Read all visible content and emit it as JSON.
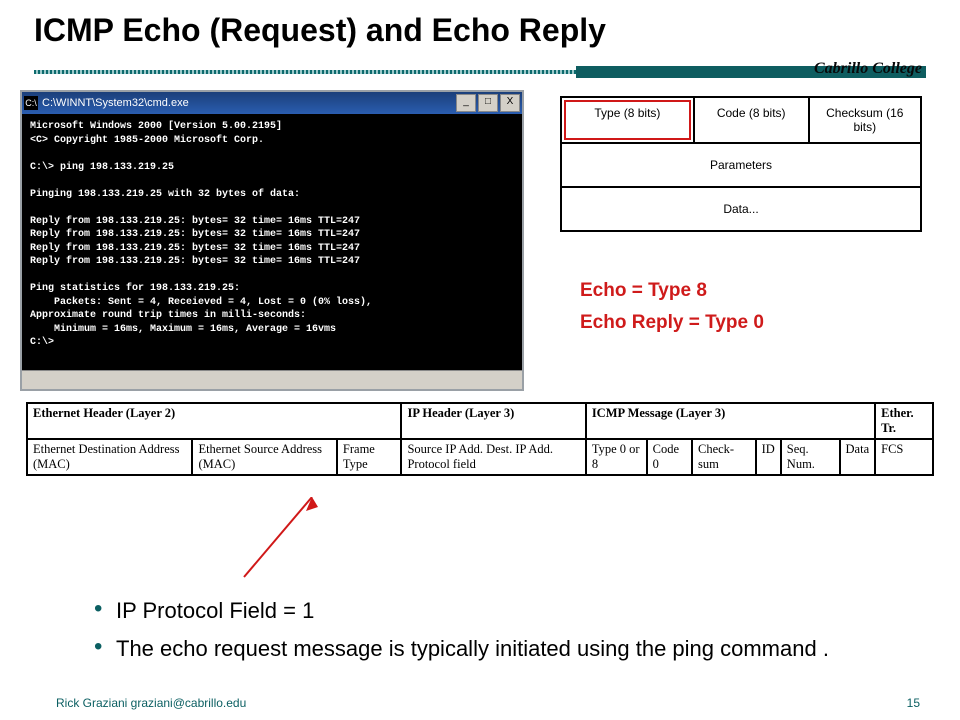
{
  "title": "ICMP Echo (Request) and Echo Reply",
  "brand": "Cabrillo College",
  "cmd": {
    "window_title": "C:\\WINNT\\System32\\cmd.exe",
    "body": "Microsoft Windows 2000 [Version 5.00.2195]\n<C> Copyright 1985-2000 Microsoft Corp.\n\nC:\\> ping 198.133.219.25\n\nPinging 198.133.219.25 with 32 bytes of data:\n\nReply from 198.133.219.25: bytes= 32 time= 16ms TTL=247\nReply from 198.133.219.25: bytes= 32 time= 16ms TTL=247\nReply from 198.133.219.25: bytes= 32 time= 16ms TTL=247\nReply from 198.133.219.25: bytes= 32 time= 16ms TTL=247\n\nPing statistics for 198.133.219.25:\n    Packets: Sent = 4, Receieved = 4, Lost = 0 (0% loss),\nApproximate round trip times in milli-seconds:\n    Minimum = 16ms, Maximum = 16ms, Average = 16vms\nC:\\>"
  },
  "icmp_header": {
    "type": "Type (8 bits)",
    "code": "Code (8 bits)",
    "checksum": "Checksum (16 bits)",
    "parameters": "Parameters",
    "data": "Data..."
  },
  "echo_note": {
    "line1": "Echo = Type 8",
    "line2": "Echo Reply = Type 0"
  },
  "packet": {
    "headers": {
      "eth": "Ethernet Header (Layer 2)",
      "ip": "IP Header (Layer 3)",
      "icmp": "ICMP Message (Layer 3)",
      "tr": "Ether. Tr."
    },
    "cells": {
      "eth_dst": "Ethernet Destination Address (MAC)",
      "eth_src": "Ethernet Source Address (MAC)",
      "frame": "Frame Type",
      "ip_fields": "Source IP Add. Dest. IP Add. Protocol field",
      "type": "Type 0 or 8",
      "code": "Code 0",
      "chk": "Check-sum",
      "id": "ID",
      "seq": "Seq. Num.",
      "data": "Data",
      "fcs": "FCS"
    }
  },
  "bullets": {
    "b1": "IP Protocol Field = 1",
    "b2": "The echo request message is typically initiated using the ping command ."
  },
  "footer": {
    "left": "Rick Graziani  graziani@cabrillo.edu",
    "right": "15"
  },
  "glyphs": {
    "min": "_",
    "max": "□",
    "close": "X",
    "cmdico": "C:\\"
  }
}
